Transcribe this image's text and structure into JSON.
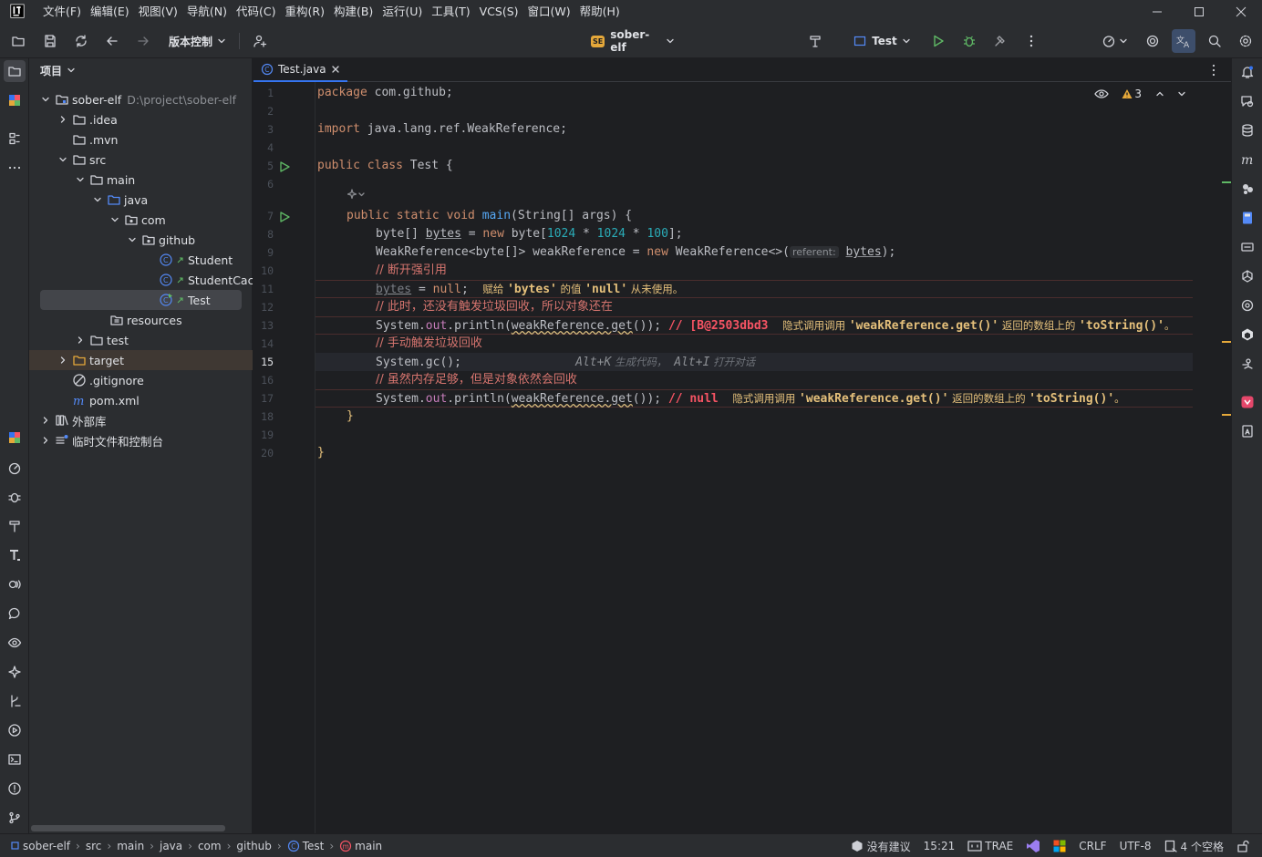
{
  "menubar": {
    "items": [
      "文件(F)",
      "编辑(E)",
      "视图(V)",
      "导航(N)",
      "代码(C)",
      "重构(R)",
      "构建(B)",
      "运行(U)",
      "工具(T)",
      "VCS(S)",
      "窗口(W)",
      "帮助(H)"
    ]
  },
  "toolbar": {
    "vcs_label": "版本控制",
    "project_badge": "SE",
    "project_name": "sober-elf",
    "run_config": "Test"
  },
  "project_panel": {
    "title": "项目",
    "tree": [
      {
        "label": "sober-elf",
        "extra": "D:\\project\\sober-elf"
      },
      {
        "label": ".idea"
      },
      {
        "label": ".mvn"
      },
      {
        "label": "src"
      },
      {
        "label": "main"
      },
      {
        "label": "java"
      },
      {
        "label": "com"
      },
      {
        "label": "github"
      },
      {
        "label": "Student"
      },
      {
        "label": "StudentCache"
      },
      {
        "label": "Test"
      },
      {
        "label": "resources"
      },
      {
        "label": "test"
      },
      {
        "label": "target"
      },
      {
        "label": ".gitignore"
      },
      {
        "label": "pom.xml"
      },
      {
        "label": "外部库"
      },
      {
        "label": "临时文件和控制台"
      }
    ]
  },
  "editor": {
    "tab_label": "Test.java",
    "warnings_count": "3",
    "line_numbers": [
      "1",
      "2",
      "3",
      "4",
      "5",
      "6",
      "7",
      "8",
      "9",
      "10",
      "11",
      "12",
      "13",
      "14",
      "15",
      "16",
      "17",
      "18",
      "19",
      "20"
    ],
    "l1": {
      "kw": "package",
      "rest": " com.github;"
    },
    "l3": {
      "kw": "import",
      "rest": " java.lang.ref.WeakReference;"
    },
    "l5": {
      "kw": "public class",
      "rest": " Test {"
    },
    "l7": {
      "kw": "public static void",
      "fn": "main",
      "rest1": "(String[] args) {"
    },
    "l8": {
      "a": "byte[] ",
      "v": "bytes",
      "b": " = ",
      "kw": "new",
      "c": " byte[",
      "n1": "1024",
      "d": " * ",
      "n2": "1024",
      "e": " * ",
      "n3": "100",
      "f": "];"
    },
    "l9": {
      "a": "WeakReference<byte[]> weakReference = ",
      "kw": "new",
      "b": " WeakReference<>(",
      "hint": "referent:",
      "v": "bytes",
      "c": ");"
    },
    "l10": {
      "c": "// 断开强引用"
    },
    "l11": {
      "v": "bytes",
      "a": " = ",
      "kw": "null",
      "b": ";",
      "inlay": "赋给 ",
      "q1": "'bytes'",
      "inlay2": " 的值 ",
      "q2": "'null'",
      "inlay3": " 从未使用。"
    },
    "l12": {
      "c": "// 此时，还没有触发垃圾回收，所以对象还在"
    },
    "l13": {
      "a": "System.",
      "f": "out",
      "b": ".println(",
      "m": "weakReference.get",
      "c": "()); ",
      "out": "// [B@2503dbd3",
      "inlay": "隐式调用调用 ",
      "q1": "'weakReference.get()'",
      "inlay2": " 返回的数组上的 ",
      "q2": "'toString()'",
      "inlay3": "。"
    },
    "l14": {
      "c": "// 手动触发垃圾回收"
    },
    "l15": {
      "a": "System.gc();",
      "k1": "Alt+K",
      "t1": " 生成代码，",
      "k2": "Alt+I",
      "t2": " 打开对话"
    },
    "l16": {
      "c": "// 虽然内存足够，但是对象依然会回收"
    },
    "l17": {
      "a": "System.",
      "f": "out",
      "b": ".println(",
      "m": "weakReference.get",
      "c": "()); ",
      "out": "// null",
      "inlay": "隐式调用调用 ",
      "q1": "'weakReference.get()'",
      "inlay2": " 返回的数组上的 ",
      "q2": "'toString()'",
      "inlay3": "。"
    },
    "l18": {
      "a": "}"
    },
    "l20": {
      "a": "}"
    }
  },
  "statusbar": {
    "breadcrumbs": [
      "sober-elf",
      "src",
      "main",
      "java",
      "com",
      "github",
      "Test",
      "main"
    ],
    "no_suggestion": "没有建议",
    "position": "15:21",
    "trae": "TRAE",
    "line_sep": "CRLF",
    "encoding": "UTF-8",
    "indent": "4 个空格"
  },
  "colors": {
    "accent": "#3574f0",
    "keyword": "#cf8e6d",
    "function": "#56a8f5",
    "number": "#2aacb8",
    "comment_red": "#d5746e",
    "inlay_warning": "#e5c07b"
  }
}
